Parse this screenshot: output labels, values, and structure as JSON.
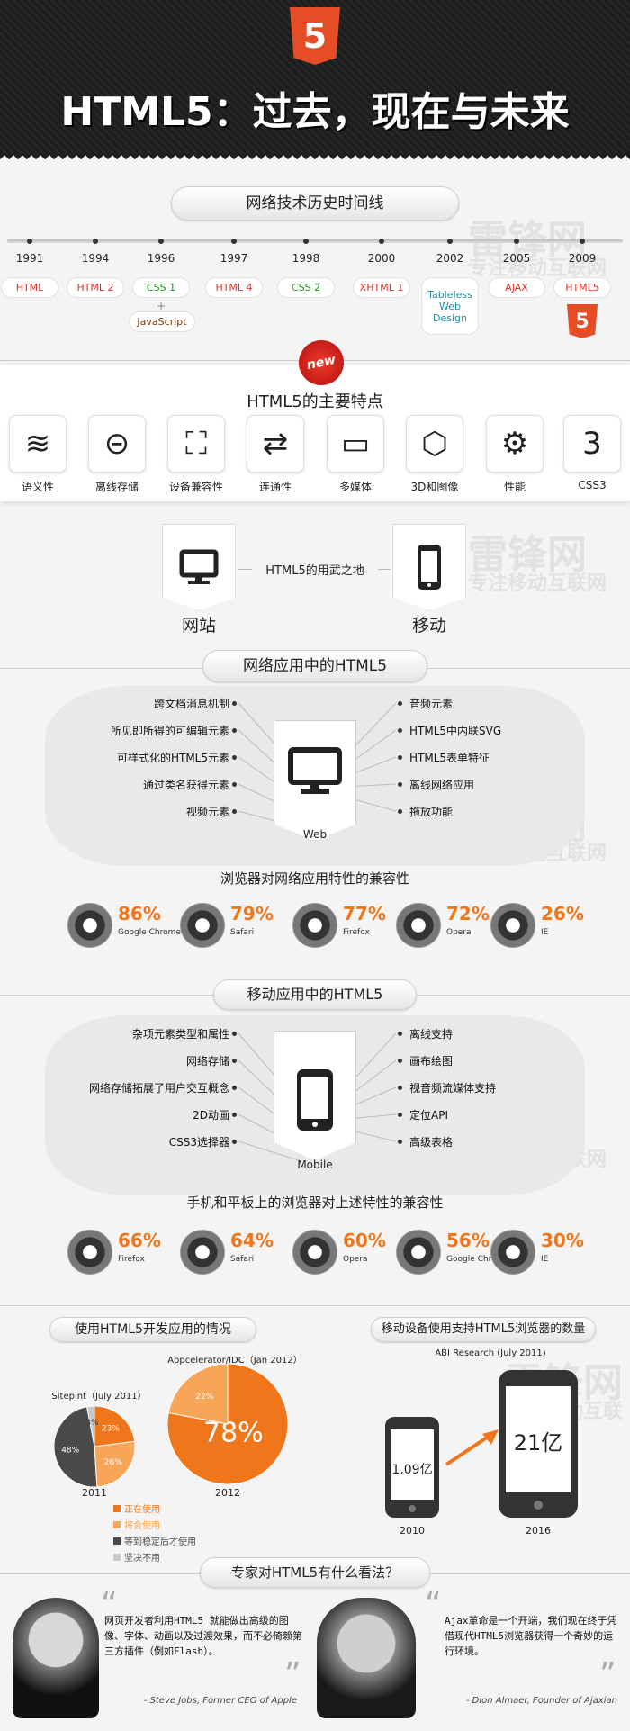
{
  "header": {
    "title": "HTML5：过去，现在与未来",
    "badge": "5"
  },
  "watermark": {
    "brand": "雷锋网",
    "slogan": "专注移动互联网"
  },
  "timeline": {
    "title": "网络技术历史时间线",
    "items": [
      {
        "year": "1991",
        "tech": "HTML",
        "color": "#d9352b"
      },
      {
        "year": "1994",
        "tech": "HTML 2",
        "color": "#d9352b"
      },
      {
        "year": "1996",
        "tech": "CSS 1",
        "color": "#1a9a1a",
        "extra": "JavaScript",
        "plus": "+"
      },
      {
        "year": "1997",
        "tech": "HTML 4",
        "color": "#d9352b"
      },
      {
        "year": "1998",
        "tech": "CSS 2",
        "color": "#1a9a1a"
      },
      {
        "year": "2000",
        "tech": "XHTML 1",
        "color": "#d9352b"
      },
      {
        "year": "2002",
        "tech": "Tableless Web Design",
        "color": "#1f8fa0"
      },
      {
        "year": "2005",
        "tech": "AJAX",
        "color": "#d9352b"
      },
      {
        "year": "2009",
        "tech": "HTML5",
        "color": "#d9352b"
      }
    ]
  },
  "features": {
    "badge": "new",
    "title": "HTML5的主要特点",
    "items": [
      {
        "label": "语义性",
        "icon": "semantics-icon",
        "glyph": "≋"
      },
      {
        "label": "离线存储",
        "icon": "offline-storage-icon",
        "glyph": "⊝"
      },
      {
        "label": "设备兼容性",
        "icon": "device-access-icon",
        "glyph": "⛶"
      },
      {
        "label": "连通性",
        "icon": "connectivity-icon",
        "glyph": "⇄"
      },
      {
        "label": "多媒体",
        "icon": "multimedia-icon",
        "glyph": "▭"
      },
      {
        "label": "3D和图像",
        "icon": "3d-graphics-icon",
        "glyph": "⬡"
      },
      {
        "label": "性能",
        "icon": "performance-icon",
        "glyph": "⚙"
      },
      {
        "label": "CSS3",
        "icon": "css3-icon",
        "glyph": "3"
      }
    ]
  },
  "platforms": {
    "center": "HTML5的用武之地",
    "left": "网站",
    "right": "移动"
  },
  "web": {
    "title": "网络应用中的HTML5",
    "center": "Web",
    "left": [
      "跨文档消息机制",
      "所见即所得的可编辑元素",
      "可样式化的HTML5元素",
      "通过类名获得元素",
      "视频元素"
    ],
    "right": [
      "音频元素",
      "HTML5中内联SVG",
      "HTML5表单特征",
      "离线网络应用",
      "拖放功能"
    ],
    "compat_title": "浏览器对网络应用特性的兼容性",
    "browsers": [
      {
        "name": "Google Chrome",
        "pct": "86%"
      },
      {
        "name": "Safari",
        "pct": "79%"
      },
      {
        "name": "Firefox",
        "pct": "77%"
      },
      {
        "name": "Opera",
        "pct": "72%"
      },
      {
        "name": "IE",
        "pct": "26%"
      }
    ]
  },
  "mobile": {
    "title": "移动应用中的HTML5",
    "center": "Mobile",
    "left": [
      "杂项元素类型和属性",
      "网络存储",
      "网络存储拓展了用户交互概念",
      "2D动画",
      "CSS3选择器"
    ],
    "right": [
      "离线支持",
      "画布绘图",
      "视音频流媒体支持",
      "定位API",
      "高级表格"
    ],
    "compat_title": "手机和平板上的浏览器对上述特性的兼容性",
    "browsers": [
      {
        "name": "Firefox",
        "pct": "66%"
      },
      {
        "name": "Safari",
        "pct": "64%"
      },
      {
        "name": "Opera",
        "pct": "60%"
      },
      {
        "name": "Google Chrome",
        "pct": "56%"
      },
      {
        "name": "IE",
        "pct": "30%"
      }
    ]
  },
  "usage": {
    "title": "使用HTML5开发应用的情况",
    "pie1": {
      "source": "Sitepint（July 2011）",
      "year": "2011",
      "slices": [
        {
          "label": "23%",
          "value": 23
        },
        {
          "label": "26%",
          "value": 26
        },
        {
          "label": "48%",
          "value": 48
        },
        {
          "label": "3%",
          "value": 3
        }
      ]
    },
    "pie2": {
      "source": "Appcelerator/IDC（Jan 2012）",
      "year": "2012",
      "slices": [
        {
          "label": "78%",
          "value": 78
        },
        {
          "label": "22%",
          "value": 22
        }
      ]
    },
    "legend": [
      {
        "label": "正在使用",
        "color": "#f0761b"
      },
      {
        "label": "将会使用",
        "color": "#f7a657"
      },
      {
        "label": "等到稳定后才使用",
        "color": "#4a4a4a"
      },
      {
        "label": "坚决不用",
        "color": "#c9c9c9"
      }
    ]
  },
  "devices": {
    "title": "移动设备使用支持HTML5浏览器的数量",
    "source": "ABI Research (July 2011)",
    "items": [
      {
        "year": "2010",
        "value": "1.09亿"
      },
      {
        "year": "2016",
        "value": "21亿"
      }
    ]
  },
  "experts": {
    "title": "专家对HTML5有什么看法？",
    "quotes": [
      {
        "text": "网页开发者利用HTML5 就能做出高级的图像、字体、动画以及过渡效果，而不必倚赖第三方插件（例如Flash）。",
        "author": "- Steve Jobs, Former CEO of Apple"
      },
      {
        "text": "Ajax革命是一个开端，我们现在终于凭借现代HTML5浏览器获得一个奇妙的运行环境。",
        "author": "- Dion Almaer, Founder of Ajaxian"
      }
    ]
  }
}
